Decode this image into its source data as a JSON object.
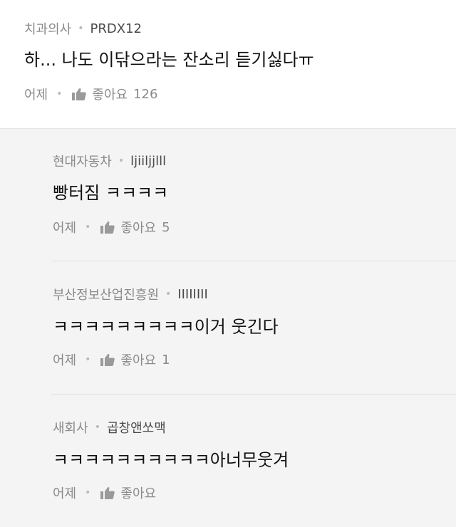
{
  "comments": [
    {
      "company": "치과의사",
      "nickname": "PRDX12",
      "text": "하... 나도 이닦으라는 잔소리 듣기싫다ㅠ",
      "date": "어제",
      "like_label": "좋아요",
      "like_count": "126"
    },
    {
      "company": "현대자동차",
      "nickname": "ljiiljjlll",
      "text": "빵터짐 ㅋㅋㅋㅋ",
      "date": "어제",
      "like_label": "좋아요",
      "like_count": "5"
    },
    {
      "company": "부산정보산업진흥원",
      "nickname": "IIIIIIII",
      "text": "ㅋㅋㅋㅋㅋㅋㅋㅋㅋ이거 웃긴다",
      "date": "어제",
      "like_label": "좋아요",
      "like_count": "1"
    },
    {
      "company": "새회사",
      "nickname": "곱창앤쏘맥",
      "text": "ㅋㅋㅋㅋㅋㅋㅋㅋㅋㅋ아너무웃겨",
      "date": "어제",
      "like_label": "좋아요",
      "like_count": ""
    }
  ],
  "separator": "•",
  "like_icon": "thumbs-up-icon"
}
